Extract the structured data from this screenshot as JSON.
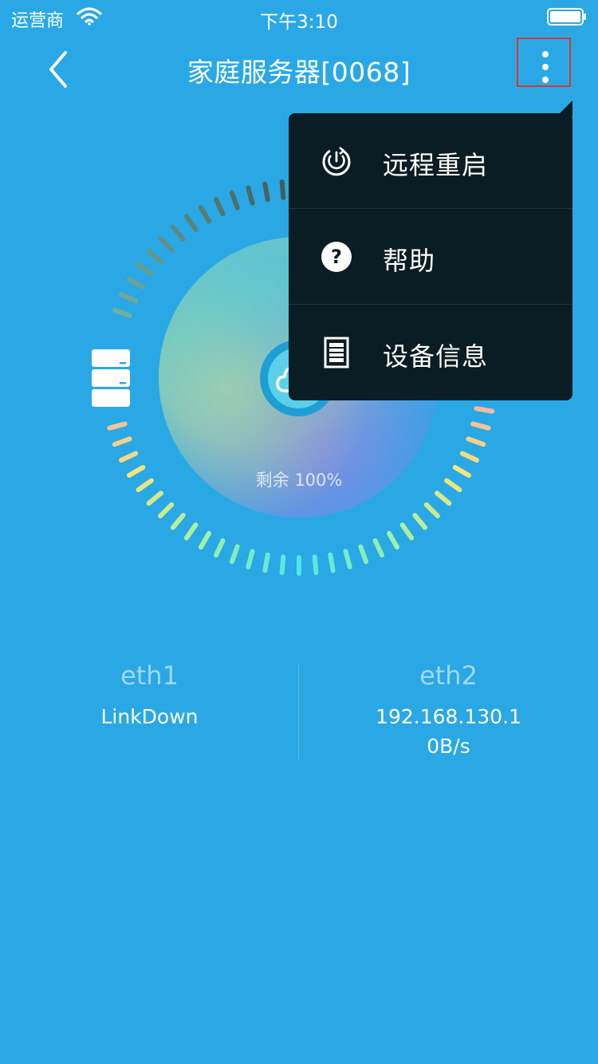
{
  "status_bar": {
    "carrier": "运营商",
    "time": "下午3:10"
  },
  "nav": {
    "title": "家庭服务器[0068]"
  },
  "gauge": {
    "remaining_label": "剩余 100%",
    "remaining_percent": 100
  },
  "interfaces": [
    {
      "name": "eth1",
      "line1": "LinkDown",
      "line2": ""
    },
    {
      "name": "eth2",
      "line1": "192.168.130.1",
      "line2": "0B/s"
    }
  ],
  "menu": {
    "items": [
      {
        "label": "远程重启",
        "icon": "power-restart-icon"
      },
      {
        "label": "帮助",
        "icon": "help-icon"
      },
      {
        "label": "设备信息",
        "icon": "document-icon"
      }
    ]
  },
  "colors": {
    "background": "#2aa8e5",
    "menu_background": "#0a1c24",
    "highlight_border": "#e0332f"
  }
}
